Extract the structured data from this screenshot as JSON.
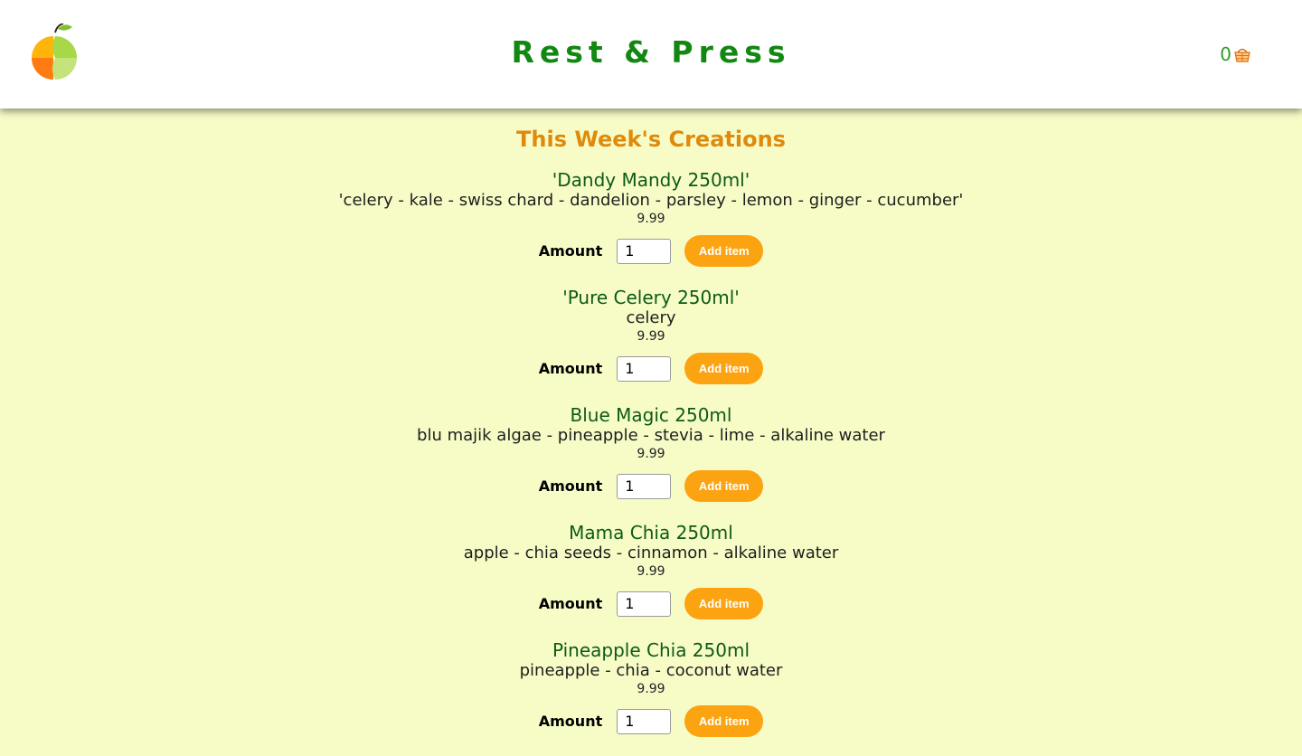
{
  "header": {
    "brand": "Rest & Press",
    "cart_count": "0"
  },
  "menu": {
    "title": "This Week's Creations",
    "amount_label": "Amount",
    "add_label": "Add item",
    "products": [
      {
        "name": "'Dandy Mandy 250ml'",
        "desc": "'celery - kale - swiss chard - dandelion - parsley - lemon - ginger - cucumber'",
        "price": "9.99",
        "qty": "1"
      },
      {
        "name": "'Pure Celery 250ml'",
        "desc": "celery",
        "price": "9.99",
        "qty": "1"
      },
      {
        "name": "Blue Magic 250ml",
        "desc": "blu majik algae - pineapple - stevia - lime - alkaline water",
        "price": "9.99",
        "qty": "1"
      },
      {
        "name": "Mama Chia 250ml",
        "desc": "apple - chia seeds - cinnamon - alkaline water",
        "price": "9.99",
        "qty": "1"
      },
      {
        "name": "Pineapple Chia 250ml",
        "desc": "pineapple - chia - coconut water",
        "price": "9.99",
        "qty": "1"
      }
    ]
  },
  "colors": {
    "brand_green": "#128812",
    "accent_orange": "#fca311",
    "title_orange": "#e08a0b",
    "background": "#f7fcc6"
  },
  "icons": {
    "logo": "fruit-logo-icon",
    "cart": "basket-icon"
  }
}
